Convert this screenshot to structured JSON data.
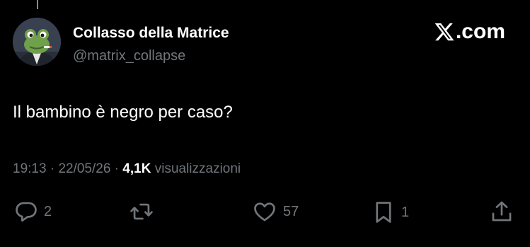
{
  "author": {
    "display_name": "Collasso della Matrice",
    "handle": "@matrix_collapse"
  },
  "brand": {
    "suffix": ".com"
  },
  "tweet": {
    "text": "Il bambino è negro per caso?"
  },
  "meta": {
    "time": "19:13",
    "date": "22/05/26",
    "separator": " · ",
    "views_count": "4,1K",
    "views_label": " visualizzazioni"
  },
  "actions": {
    "replies": "2",
    "reposts": "",
    "likes": "57",
    "bookmarks": "1"
  },
  "colors": {
    "background": "#000000",
    "primary_text": "#ffffff",
    "secondary_text": "#71767b"
  }
}
